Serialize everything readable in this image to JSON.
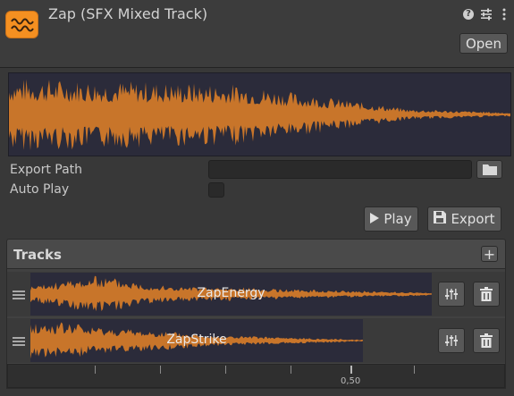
{
  "header": {
    "title": "Zap (SFX Mixed Track)",
    "open_label": "Open",
    "icons": [
      "sfx-wave-icon",
      "help-icon",
      "settings-sliders-icon",
      "more-vertical-icon"
    ]
  },
  "fields": {
    "export_path_label": "Export Path",
    "export_path_value": "",
    "auto_play_label": "Auto Play",
    "auto_play_checked": false
  },
  "actions": {
    "play_label": "Play",
    "export_label": "Export"
  },
  "tracks": {
    "title": "Tracks",
    "items": [
      {
        "name": "ZapEnergy"
      },
      {
        "name": "ZapStrike"
      }
    ]
  },
  "timeline": {
    "label": "0,50"
  },
  "colors": {
    "accent": "#f59021",
    "waveform": "#c8752a",
    "waveform_bg": "#2b2b3a"
  }
}
